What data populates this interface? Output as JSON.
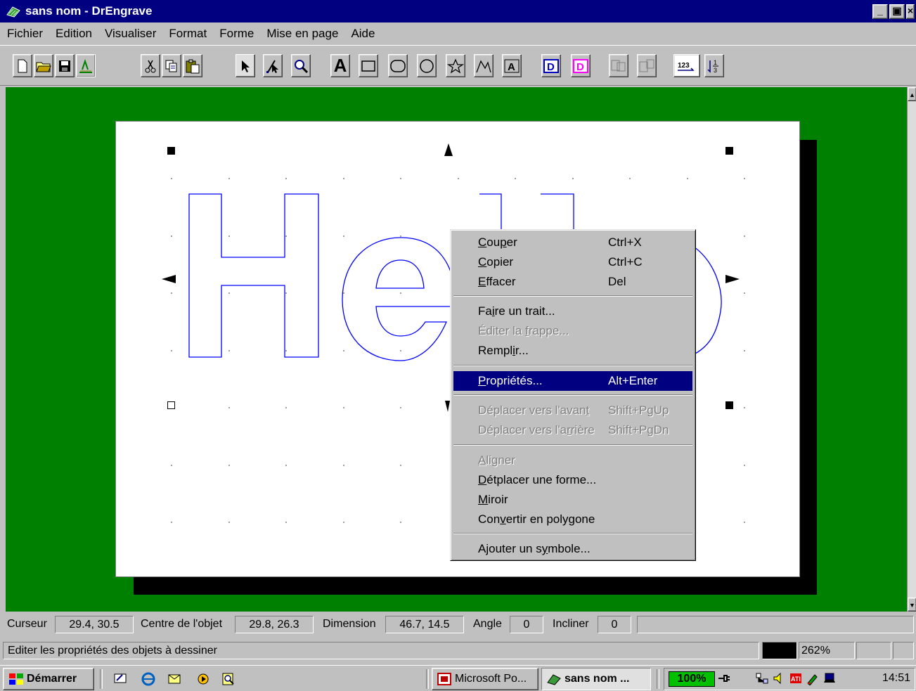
{
  "window": {
    "title": "sans nom - DrEngrave"
  },
  "window_buttons": [
    "_",
    "Β",
    "×"
  ],
  "menu": [
    "Fichier",
    "Edition",
    "Visualiser",
    "Format",
    "Forme",
    "Mise en page",
    "Aide"
  ],
  "toolbar_icons": [
    "new-file-icon",
    "open-folder-icon",
    "save-icon",
    "engrave-icon",
    "cut-icon",
    "copy-icon",
    "paste-icon",
    "select-arrow-icon",
    "node-edit-icon",
    "zoom-icon",
    "text-tool-icon",
    "rectangle-tool-icon",
    "rounded-rect-tool-icon",
    "ellipse-tool-icon",
    "star-tool-icon",
    "polyline-tool-icon",
    "text-frame-tool-icon",
    "d-tool-icon",
    "d-pink-tool-icon",
    "group-icon",
    "ungroup-icon",
    "numbering-icon",
    "fraction-icon"
  ],
  "text_tool_glyph": "A",
  "canvas": {
    "text": "Hello",
    "outline_color": "#0000ff",
    "workspace_color": "#008000"
  },
  "context_menu": {
    "items": [
      {
        "label": "Couper",
        "shortcut": "Ctrl+X",
        "enabled": true
      },
      {
        "label": "Copier",
        "shortcut": "Ctrl+C",
        "enabled": true
      },
      {
        "label": "Effacer",
        "shortcut": "Del",
        "enabled": true
      },
      {
        "label": "Faire un trait...",
        "shortcut": "",
        "enabled": true
      },
      {
        "label": "Éditer la frappe...",
        "shortcut": "",
        "enabled": false
      },
      {
        "label": "Remplir...",
        "shortcut": "",
        "enabled": true
      },
      {
        "label": "Propriétés...",
        "shortcut": "Alt+Enter",
        "enabled": true,
        "selected": true
      },
      {
        "label": "Déplacer vers l'avant",
        "shortcut": "Shift+PgUp",
        "enabled": false
      },
      {
        "label": "Déplacer vers l'arrière",
        "shortcut": "Shift+PgDn",
        "enabled": false
      },
      {
        "label": "Aligner",
        "shortcut": "",
        "enabled": false
      },
      {
        "label": "Détplacer une forme...",
        "shortcut": "",
        "enabled": true
      },
      {
        "label": "Miroir",
        "shortcut": "",
        "enabled": true
      },
      {
        "label": "Convertir en polygone",
        "shortcut": "",
        "enabled": true
      },
      {
        "label": "Ajouter un symbole...",
        "shortcut": "",
        "enabled": true
      }
    ]
  },
  "status": {
    "cursor_label": "Curseur",
    "cursor_value": "29.4, 30.5",
    "center_label": "Centre de l'objet",
    "center_value": "29.8, 26.3",
    "dimension_label": "Dimension",
    "dimension_value": "46.7, 14.5",
    "angle_label": "Angle",
    "angle_value": "0",
    "incline_label": "Incliner",
    "incline_value": "0",
    "hint": "Editer les propriétés des objets à dessiner",
    "zoom": "262%"
  },
  "taskbar": {
    "start_label": "Démarrer",
    "quicklaunch": [
      "desktop-icon",
      "ie-icon",
      "outlook-icon",
      "media-icon",
      "search-icon"
    ],
    "tasks": [
      {
        "label": "Microsoft Po...",
        "active": false
      },
      {
        "label": "sans nom ...",
        "active": true
      }
    ],
    "battery": "100%",
    "tray_icons": [
      "plug-icon",
      "network-icon",
      "volume-icon",
      "ati-icon",
      "edit-icon",
      "laptop-icon"
    ],
    "clock": "14:51"
  }
}
